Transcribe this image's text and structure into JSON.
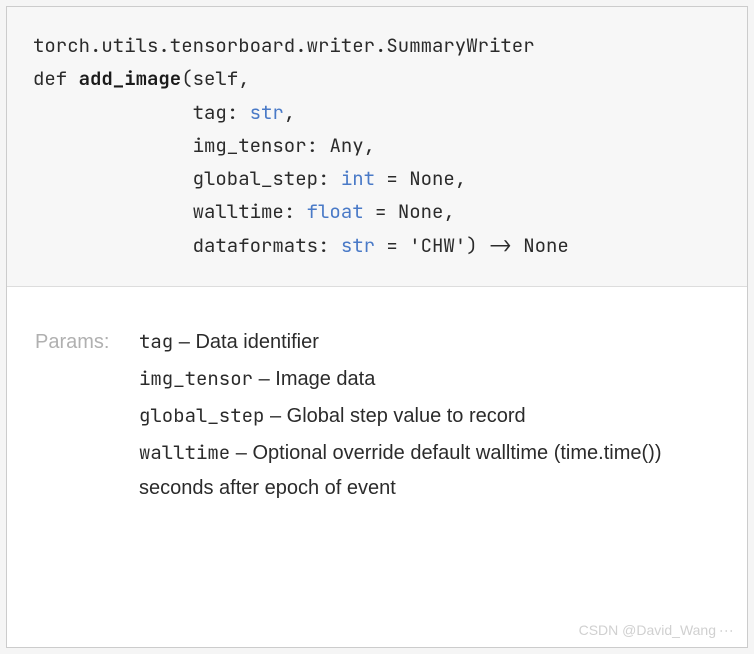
{
  "signature": {
    "module_path": "torch.utils.tensorboard.writer.SummaryWriter",
    "def_kw": "def ",
    "fn_name": "add_image",
    "open": "(self,",
    "indent": "              ",
    "params": [
      {
        "name": "tag",
        "colon": ": ",
        "type": "str",
        "rest": ","
      },
      {
        "name": "img_tensor",
        "colon": ": ",
        "type": "Any",
        "rest": ","
      },
      {
        "name": "global_step",
        "colon": ": ",
        "type": "int",
        "rest": " = None,"
      },
      {
        "name": "walltime",
        "colon": ": ",
        "type": "float",
        "rest": " = None,"
      },
      {
        "name": "dataformats",
        "colon": ": ",
        "type": "str",
        "rest": " = 'CHW') -> None"
      }
    ]
  },
  "doc": {
    "params_label": "Params:",
    "params": [
      {
        "name": "tag",
        "sep": " – ",
        "desc": "Data identifier"
      },
      {
        "name": "img_tensor",
        "sep": " – ",
        "desc": "Image data"
      },
      {
        "name": "global_step",
        "sep": " – ",
        "desc": "Global step value to record"
      },
      {
        "name": "walltime",
        "sep": " – ",
        "desc": "Optional override default walltime (time.time()) seconds after epoch of event"
      }
    ]
  },
  "watermark": "CSDN @David_Wang"
}
